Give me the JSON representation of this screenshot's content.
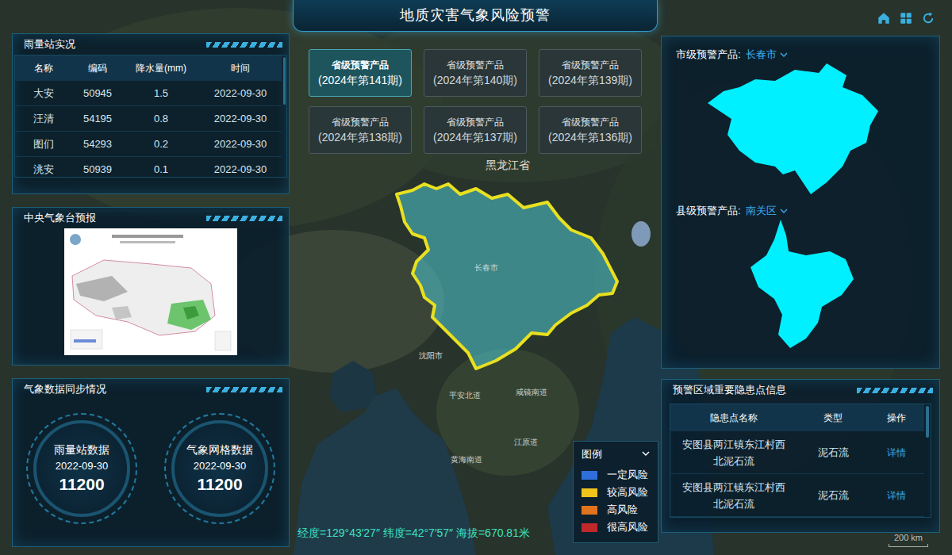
{
  "title": "地质灾害气象风险预警",
  "rain_stations": {
    "title": "雨量站实况",
    "columns": [
      "名称",
      "编码",
      "降水量(mm)",
      "时间"
    ],
    "rows": [
      [
        "大安",
        "50945",
        "1.5",
        "2022-09-30"
      ],
      [
        "汪清",
        "54195",
        "0.8",
        "2022-09-30"
      ],
      [
        "图们",
        "54293",
        "0.2",
        "2022-09-30"
      ],
      [
        "洮安",
        "50939",
        "0.1",
        "2022-09-30"
      ]
    ]
  },
  "forecast": {
    "title": "中央气象台预报"
  },
  "sync": {
    "title": "气象数据同步情况",
    "items": [
      {
        "label": "雨量站数据",
        "date": "2022-09-30",
        "count": "11200"
      },
      {
        "label": "气象网格数据",
        "date": "2022-09-30",
        "count": "11200"
      }
    ]
  },
  "products": [
    {
      "name": "省级预警产品",
      "issue": "(2024年第141期)",
      "selected": true
    },
    {
      "name": "省级预警产品",
      "issue": "(2024年第140期)",
      "selected": false
    },
    {
      "name": "省级预警产品",
      "issue": "(2024年第139期)",
      "selected": false
    },
    {
      "name": "省级预警产品",
      "issue": "(2024年第138期)",
      "selected": false
    },
    {
      "name": "省级预警产品",
      "issue": "(2024年第137期)",
      "selected": false
    },
    {
      "name": "省级预警产品",
      "issue": "(2024年第136期)",
      "selected": false
    }
  ],
  "city": {
    "label": "市级预警产品:",
    "value": "长春市"
  },
  "county": {
    "label": "县级预警产品:",
    "value": "南关区"
  },
  "hazards": {
    "title": "预警区域重要隐患点信息",
    "columns": [
      "隐患点名称",
      "类型",
      "操作"
    ],
    "rows": [
      {
        "name": "安图县两江镇东江村西北泥石流",
        "type": "泥石流",
        "action": "详情"
      },
      {
        "name": "安图县两江镇东江村西北泥石流",
        "type": "泥石流",
        "action": "详情"
      }
    ]
  },
  "legend": {
    "title": "图例",
    "items": [
      {
        "label": "一定风险",
        "color": "#2f6fdc"
      },
      {
        "label": "较高风险",
        "color": "#f0c41c"
      },
      {
        "label": "高风险",
        "color": "#e0731c"
      },
      {
        "label": "很高风险",
        "color": "#c0282a"
      }
    ]
  },
  "map": {
    "labels": [
      "黑龙江省",
      "长春市",
      "沈阳市",
      "平安北道",
      "咸镜南道",
      "江原道",
      "黄海南道"
    ],
    "coordinates": "经度=129°43′27″ 纬度=42°7′57″ 海拔=670.81米",
    "scale": "200 km"
  }
}
